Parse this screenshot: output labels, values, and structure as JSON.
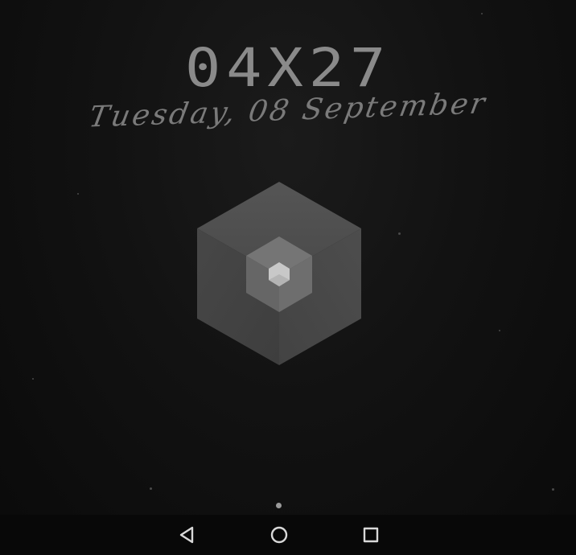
{
  "lockscreen": {
    "time": "04X27",
    "date": "Tuesday, 08 September",
    "colors": {
      "background": "#0c0c0c",
      "clock_text": "#8a8a8a",
      "date_text": "#7a7a7a",
      "cube_outer": "#4a4a4a",
      "cube_middle": "#707070",
      "cube_core": "#c8c8c8"
    }
  },
  "widget": {
    "icon": "hexagon-cube-icon"
  },
  "pager": {
    "page_count": 1,
    "current_page": 1
  },
  "navbar": {
    "back_icon": "back-triangle-icon",
    "home_icon": "home-circle-icon",
    "recents_icon": "recents-square-icon"
  }
}
